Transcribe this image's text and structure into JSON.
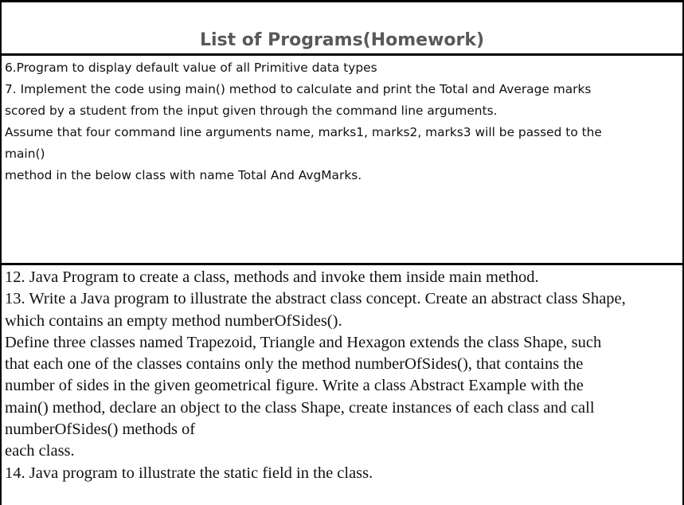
{
  "title": "List of Programs(Homework)",
  "section_a": {
    "lines": [
      "6.Program to display default value of all Primitive data types",
      "7. Implement the code using main() method to calculate and print the Total and Average marks",
      "scored by a student from the input given through the command line arguments.",
      "Assume that four command line arguments name, marks1, marks2, marks3 will be passed to the",
      "main()",
      "method in the below class with name Total And AvgMarks."
    ]
  },
  "section_b": {
    "lines": [
      "12. Java Program to create a class, methods and invoke them inside main method.",
      "13. Write a Java program to illustrate the abstract class concept. Create an abstract class Shape,",
      "which contains an empty method numberOfSides().",
      "Define three classes named Trapezoid, Triangle and Hexagon extends the class Shape, such",
      "that each one of the classes contains only the method numberOfSides(), that contains the",
      "number of sides in the given geometrical figure. Write a class Abstract Example with the",
      "main() method, declare an object to the class Shape, create instances of each class and call",
      "numberOfSides() methods of",
      "each class.",
      "14. Java program to illustrate the static field in the class."
    ]
  }
}
